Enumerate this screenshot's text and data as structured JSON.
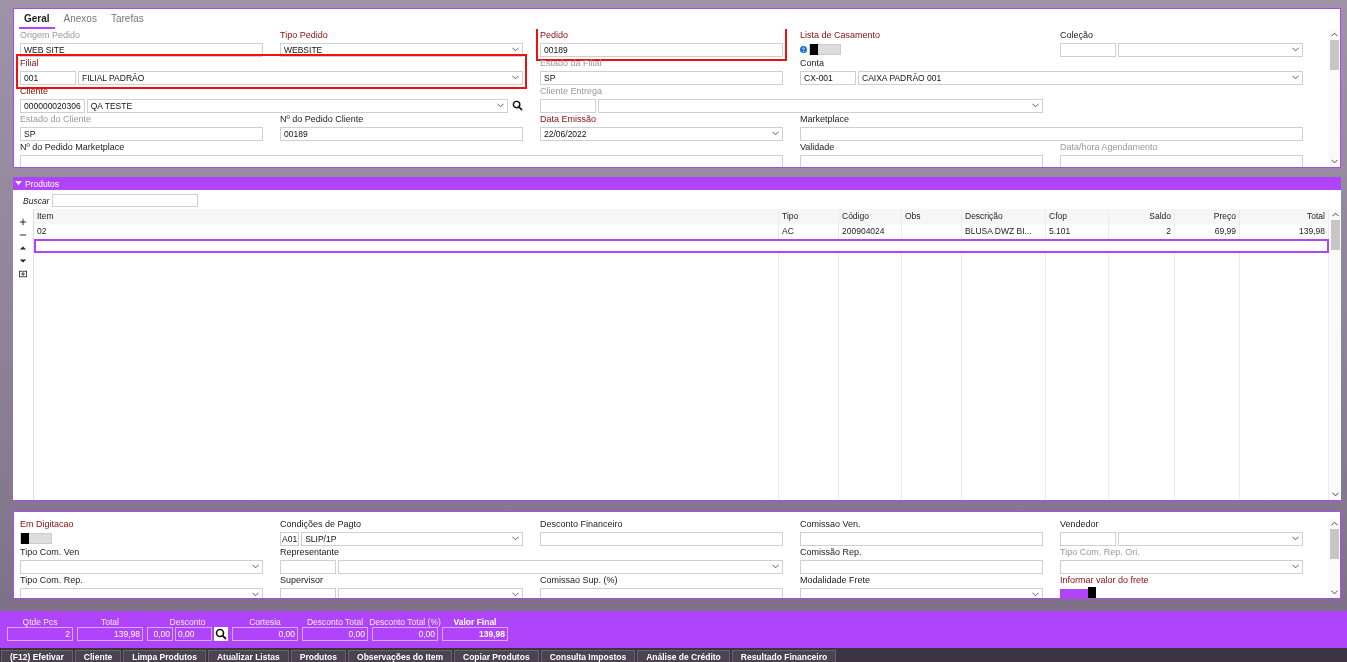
{
  "tabs": [
    {
      "label": "Geral",
      "selected": true
    },
    {
      "label": "Anexos",
      "selected": false
    },
    {
      "label": "Tarefas",
      "selected": false
    }
  ],
  "header_form": [
    [
      {
        "label": "Origem Pedido",
        "required": false,
        "disabled": true,
        "kind": "text",
        "value": "WEB SITE"
      },
      {
        "label": "Tipo Pedido",
        "required": true,
        "disabled": false,
        "kind": "select",
        "value": "WEBSITE"
      },
      {
        "label": "Pedido",
        "required": true,
        "disabled": false,
        "kind": "text",
        "value": "00189",
        "highlighted": true
      },
      {
        "label": "Lista de Casamento",
        "required": true,
        "disabled": false,
        "kind": "toggle",
        "on": false,
        "help": true
      },
      {
        "label": "Coleção",
        "required": false,
        "disabled": false,
        "kind": "pair"
      }
    ],
    [
      {
        "label": "Filial",
        "required": true,
        "disabled": false,
        "kind": "pair",
        "code": "001",
        "value": "FILIAL PADRÃO",
        "wide": true,
        "highlighted": true
      },
      {
        "label": "Estado da Filial",
        "required": false,
        "disabled": true,
        "kind": "text",
        "value": "SP"
      },
      {
        "label": "Conta",
        "required": false,
        "disabled": false,
        "kind": "pair",
        "code": "CX-001",
        "value": "CAIXA PADRÃO 001",
        "wide": true
      }
    ],
    [
      {
        "label": "Cliente",
        "required": true,
        "disabled": false,
        "kind": "pair",
        "code": "000000020306",
        "value": "QA TESTE",
        "wide": true,
        "search": true
      },
      {
        "label": "Cliente Entrega",
        "required": false,
        "disabled": true,
        "kind": "pair",
        "wide": true
      }
    ],
    [
      {
        "label": "Estado do Cliente",
        "required": false,
        "disabled": true,
        "kind": "text",
        "value": "SP"
      },
      {
        "label": "Nº do Pedido Cliente",
        "required": false,
        "disabled": false,
        "kind": "text",
        "value": "00189"
      },
      {
        "label": "Data Emissão",
        "required": true,
        "disabled": false,
        "kind": "select",
        "value": "22/06/2022"
      },
      {
        "label": "Marketplace",
        "required": false,
        "disabled": false,
        "kind": "text",
        "wide": true
      }
    ],
    [
      {
        "label": "Nº do Pedido Marketplace",
        "required": false,
        "disabled": false,
        "kind": "text",
        "extra_wide": true
      },
      {
        "label": "Validade",
        "required": false,
        "disabled": false,
        "kind": "text"
      },
      {
        "label": "Data/hora Agendamento",
        "required": false,
        "disabled": true,
        "kind": "text"
      }
    ]
  ],
  "products": {
    "title": "Produtos",
    "expanded": true,
    "search_label": "Buscar",
    "columns": [
      {
        "label": "Item",
        "right_aligned": false
      },
      {
        "label": "Tipo",
        "right_aligned": false
      },
      {
        "label": "Código",
        "right_aligned": false
      },
      {
        "label": "Obs",
        "right_aligned": false
      },
      {
        "label": "Descrição",
        "right_aligned": false
      },
      {
        "label": "Cfop",
        "right_aligned": false
      },
      {
        "label": "Saldo",
        "right_aligned": true
      },
      {
        "label": "Preço",
        "right_aligned": true
      },
      {
        "label": "Total",
        "right_aligned": true
      }
    ],
    "rows": [
      {
        "cells": [
          "02",
          "AC",
          "200904024",
          null,
          "BLUSA DWZ BI...",
          "5.101",
          "2",
          "69,99",
          "139,98"
        ]
      }
    ],
    "entry_row": {
      "selected": true
    }
  },
  "footer_form": [
    [
      {
        "label": "Em Digitacao",
        "required": true,
        "disabled": false,
        "kind": "toggle",
        "on": false
      },
      {
        "label": "Condições de Pagto",
        "required": false,
        "disabled": false,
        "kind": "pair",
        "code": "A01",
        "value": "SLIP/1P",
        "narrow_code": true
      },
      {
        "label": "Desconto Financeiro",
        "required": false,
        "disabled": false,
        "kind": "text"
      },
      {
        "label": "Comissao Ven.",
        "required": false,
        "disabled": false,
        "kind": "text"
      },
      {
        "label": "Vendedor",
        "required": false,
        "disabled": false,
        "kind": "pair"
      }
    ],
    [
      {
        "label": "Tipo Com. Ven",
        "required": false,
        "disabled": false,
        "kind": "select"
      },
      {
        "label": "Representante",
        "required": false,
        "disabled": false,
        "kind": "pair",
        "wide": true
      },
      {
        "label": "Comissão Rep.",
        "required": false,
        "disabled": false,
        "kind": "text"
      },
      {
        "label": "Tipo Com. Rep. Ori.",
        "required": false,
        "disabled": true,
        "kind": "select"
      }
    ],
    [
      {
        "label": "Tipo Com. Rep.",
        "required": false,
        "disabled": false,
        "kind": "select"
      },
      {
        "label": "Supervisor",
        "required": false,
        "disabled": false,
        "kind": "pair"
      },
      {
        "label": "Comissao Sup. (%)",
        "required": false,
        "disabled": false,
        "kind": "text"
      },
      {
        "label": "Modalidade Frete",
        "required": false,
        "disabled": false,
        "kind": "select"
      },
      {
        "label": "Informar valor do frete",
        "required": true,
        "disabled": false,
        "kind": "toggle",
        "on": true
      }
    ]
  ],
  "totals": [
    {
      "label": "Qtde Pcs",
      "kind": "plain",
      "value": "2",
      "bold": false
    },
    {
      "label": "Total",
      "kind": "plain",
      "value": "139,98",
      "bold": false
    },
    {
      "label": "Desconto",
      "kind": "discount",
      "percent": "0,00",
      "value": "0,00",
      "bold": false
    },
    {
      "label": "Cortesia",
      "kind": "plain",
      "value": "0,00",
      "bold": false
    },
    {
      "label": "Desconto Total",
      "kind": "plain",
      "value": "0,00",
      "bold": false
    },
    {
      "label": "Desconto Total (%)",
      "kind": "plain",
      "value": "0,00",
      "bold": false
    },
    {
      "label": "Valor Final",
      "kind": "plain",
      "value": "139,98",
      "bold": true
    }
  ],
  "actions": [
    "(F12) Efetivar",
    "Cliente",
    "Limpa Produtos",
    "Atualizar Listas",
    "Produtos",
    "Observações do Item",
    "Copiar Produtos",
    "Consulta Impostos",
    "Análise de Crédito",
    "Resultado Financeiro"
  ]
}
